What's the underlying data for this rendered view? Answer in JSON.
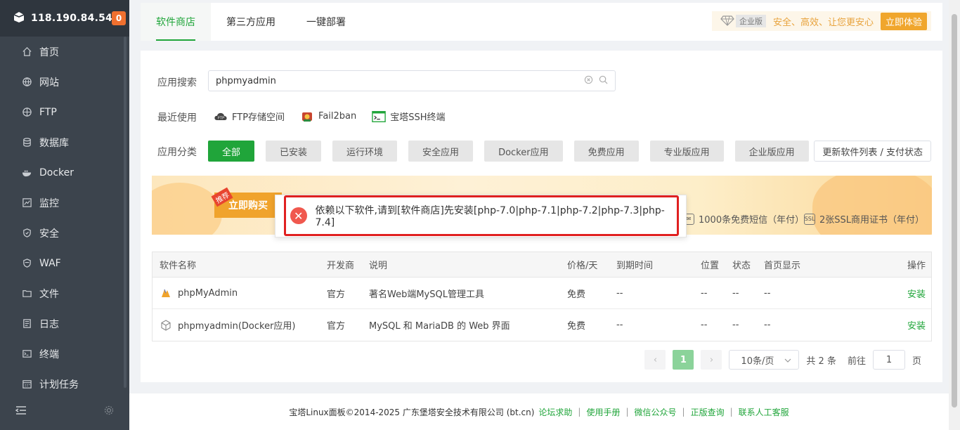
{
  "sidebar": {
    "ip": "118.190.84.54",
    "badge": "0",
    "items": [
      {
        "label": "首页",
        "icon": "home-icon"
      },
      {
        "label": "网站",
        "icon": "globe-icon"
      },
      {
        "label": "FTP",
        "icon": "ftp-icon"
      },
      {
        "label": "数据库",
        "icon": "database-icon"
      },
      {
        "label": "Docker",
        "icon": "docker-icon"
      },
      {
        "label": "监控",
        "icon": "monitor-icon"
      },
      {
        "label": "安全",
        "icon": "shield-icon"
      },
      {
        "label": "WAF",
        "icon": "waf-icon"
      },
      {
        "label": "文件",
        "icon": "folder-icon"
      },
      {
        "label": "日志",
        "icon": "log-icon"
      },
      {
        "label": "终端",
        "icon": "terminal-icon"
      },
      {
        "label": "计划任务",
        "icon": "calendar-icon"
      }
    ]
  },
  "tabs": [
    "软件商店",
    "第三方应用",
    "一键部署"
  ],
  "promo": {
    "edition": "企业版",
    "slogan": "安全、高效、让您更安心",
    "try": "立即体验"
  },
  "search": {
    "label": "应用搜索",
    "value": "phpmyadmin"
  },
  "recent": {
    "label": "最近使用",
    "items": [
      "FTP存储空间",
      "Fail2ban",
      "宝塔SSH终端"
    ]
  },
  "categories": {
    "label": "应用分类",
    "items": [
      "全部",
      "已安装",
      "运行环境",
      "安全应用",
      "Docker应用",
      "免费应用",
      "专业版应用",
      "企业版应用"
    ],
    "refresh": "更新软件列表 / 支付状态"
  },
  "banner": {
    "buy": "立即购买",
    "recommend": "推荐",
    "perk1": "1000条免费短信（年付）",
    "perk2": "2张SSL商用证书（年付）"
  },
  "toast": {
    "message": "依赖以下软件,请到[软件商店]先安装[php-7.0|php-7.1|php-7.2|php-7.3|php-7.4]"
  },
  "table": {
    "headers": [
      "软件名称",
      "开发商",
      "说明",
      "价格/天",
      "到期时间",
      "位置",
      "状态",
      "首页显示",
      "操作"
    ],
    "rows": [
      {
        "name": "phpMyAdmin",
        "dev": "官方",
        "desc": "著名Web端MySQL管理工具",
        "price": "免费",
        "exp": "--",
        "pos": "--",
        "stat": "--",
        "home": "--",
        "op": "安装"
      },
      {
        "name": "phpmyadmin(Docker应用)",
        "dev": "官方",
        "desc": "MySQL 和 MariaDB 的 Web 界面",
        "price": "免费",
        "exp": "--",
        "pos": "--",
        "stat": "--",
        "home": "--",
        "op": "安装"
      }
    ]
  },
  "pager": {
    "page": "1",
    "size": "10条/页",
    "total": "共 2 条",
    "goto": "前往",
    "goto_value": "1",
    "unit": "页"
  },
  "footer": {
    "copyright": "宝塔Linux面板©2014-2025 广东堡塔安全技术有限公司 (bt.cn)",
    "links": [
      "论坛求助",
      "使用手册",
      "微信公众号",
      "正版查询",
      "联系人工客服"
    ]
  }
}
